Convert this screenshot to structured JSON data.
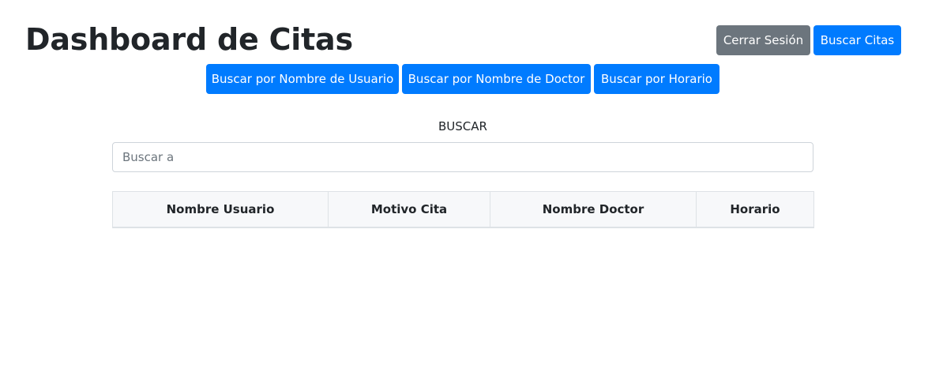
{
  "header": {
    "title": "Dashboard de Citas",
    "logout_label": "Cerrar Sesión",
    "search_appointments_label": "Buscar Citas"
  },
  "filters": {
    "by_user_label": "Buscar por Nombre de Usuario",
    "by_doctor_label": "Buscar por Nombre de Doctor",
    "by_schedule_label": "Buscar por Horario"
  },
  "search": {
    "label": "BUSCAR",
    "placeholder": "Buscar a",
    "value": ""
  },
  "table": {
    "columns": [
      "Nombre Usuario",
      "Motivo Cita",
      "Nombre Doctor",
      "Horario"
    ],
    "rows": []
  },
  "colors": {
    "primary": "#007bff",
    "secondary": "#6c757d",
    "table_header_bg": "#f7f8fa",
    "border": "#dee2e6"
  }
}
